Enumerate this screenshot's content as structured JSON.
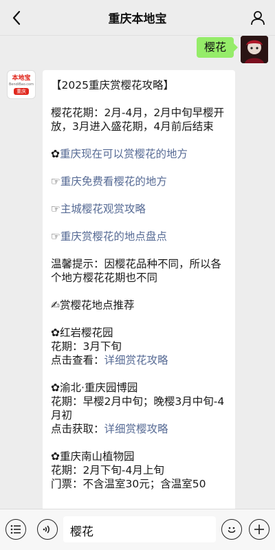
{
  "header": {
    "title": "重庆本地宝"
  },
  "outgoing": {
    "text": "樱花"
  },
  "bot": {
    "logo_top": "本地宝",
    "logo_mid": "BendiBao.com",
    "logo_badge": "重庆"
  },
  "message": {
    "heading": "【2025重庆赏樱花攻略】",
    "intro": "樱花花期：2月-4月，2月中旬早樱开放，3月进入盛花期，4月前后结束",
    "links": [
      {
        "prefix": "✿",
        "text": "重庆现在可以赏樱花的地方"
      },
      {
        "prefix": "☞",
        "text": "重庆免费看樱花的地方"
      },
      {
        "prefix": "☞",
        "text": "主城樱花观赏攻略"
      },
      {
        "prefix": "☞",
        "text": "重庆赏樱花的地点盘点"
      }
    ],
    "tip": "温馨提示：因樱花品种不同，所以各个地方樱花花期也不同",
    "recommend_title": "✍赏樱花地点推荐",
    "places": [
      {
        "name": "✿红岩樱花园",
        "period": "花期：3月下旬",
        "action_label": "点击查看：",
        "action_link": "详细赏花攻略"
      },
      {
        "name": "✿渝北·重庆园博园",
        "period": "花期：早樱2月中旬；晚樱3月中旬-4月初",
        "action_label": "点击获取：",
        "action_link": "详细赏樱攻略"
      },
      {
        "name": "✿重庆南山植物园",
        "period": "花期：2月下旬-4月上旬",
        "ticket": "门票：不含温室30元；含温室50"
      }
    ]
  },
  "input": {
    "value": "樱花"
  }
}
